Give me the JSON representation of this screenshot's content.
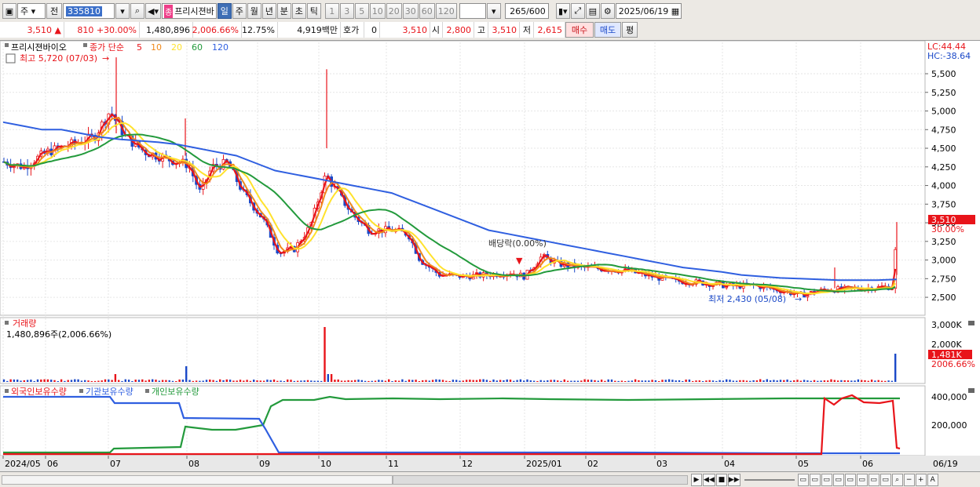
{
  "toolbar": {
    "market_type": "주",
    "prev_label": "전",
    "stock_code": "335810",
    "stock_name_badge": "종",
    "stock_name": "프리시젼바",
    "periods": [
      "일",
      "주",
      "월",
      "년",
      "분",
      "초",
      "틱"
    ],
    "active_period": "일",
    "intervals": [
      "1",
      "3",
      "5",
      "10",
      "20",
      "30",
      "60",
      "120"
    ],
    "data_count": "265",
    "data_total": "/600",
    "date": "2025/06/19"
  },
  "quote": {
    "price": "3,510",
    "change": "810",
    "change_pct": "+30.00%",
    "volume": "1,480,896",
    "volume_ratio": "2,006.66%",
    "turnover": "12.75%",
    "amount": "4,919백만",
    "hoga_label": "호가",
    "hoga_value": "0",
    "hoga_price": "3,510",
    "open_label": "시",
    "open": "2,800",
    "high_label": "고",
    "high": "3,510",
    "low_label": "저",
    "low": "2,615",
    "buy_label": "매수",
    "sell_label": "매도",
    "eval_label": "평"
  },
  "price_panel": {
    "legend_name": "프리시젼바이오",
    "legend_ma_title": "종가 단순",
    "ma_periods": [
      "5",
      "10",
      "20",
      "60",
      "120"
    ],
    "ma_colors": [
      "#e8141a",
      "#f08a1c",
      "#ffe22d",
      "#239a3c",
      "#2f5fe0"
    ],
    "max_label": "최고 5,720 (07/03)",
    "min_label": "최저 2,430 (05/08)",
    "dividend_label": "배당락(0.00%)",
    "lc_label": "LC:44.44",
    "hc_label": "HC:-38.64",
    "last_price_tag": "3,510",
    "last_pct_tag": "30.00%",
    "y_ticks": [
      "5,500",
      "5,250",
      "5,000",
      "4,750",
      "4,500",
      "4,250",
      "4,000",
      "3,750",
      "3,500",
      "3,250",
      "3,000",
      "2,750",
      "2,500"
    ]
  },
  "volume_panel": {
    "title": "거래량",
    "value": "1,480,896주(2,006.66%)",
    "y_ticks": [
      "3,000K",
      "2,000K",
      "1,000K"
    ],
    "last_tag": "1,481K",
    "last_pct_tag": "2006.66%"
  },
  "holdings_panel": {
    "legends": [
      "외국인보유수량",
      "기관보유수량",
      "개인보유수량"
    ],
    "legend_colors": [
      "#e8141a",
      "#2f5fe0",
      "#239a3c"
    ],
    "y_ticks": [
      "400,000",
      "200,000"
    ]
  },
  "x_axis": [
    "2024/05",
    "06",
    "07",
    "08",
    "09",
    "10",
    "11",
    "12",
    "2025/01",
    "02",
    "03",
    "04",
    "05",
    "06"
  ],
  "x_axis_right": "06/19",
  "colors": {
    "up": "#e8141a",
    "down": "#1b49c8",
    "selection": "#3f6fb6"
  },
  "chart_data": {
    "type": "line",
    "series": [
      {
        "name": "5",
        "values": [
          4300,
          4350,
          4600,
          4750,
          5000,
          4650,
          4400,
          4250,
          4150,
          3900,
          4100,
          4250,
          3700,
          3300,
          3100,
          3400,
          4100,
          3800,
          3500,
          3450,
          3300,
          3100,
          2900,
          2800,
          2780,
          2800,
          2820,
          2850,
          3050,
          2980,
          2900,
          2870,
          2820,
          2800,
          2750,
          2720,
          2700,
          2680,
          2700,
          2650,
          2600,
          2580,
          2620,
          2600,
          2620,
          2700,
          3510
        ]
      },
      {
        "name": "120",
        "values": [
          4850,
          4800,
          4750,
          4750,
          4700,
          4650,
          4620,
          4600,
          4580,
          4550,
          4500,
          4450,
          4400,
          4300,
          4200,
          4150,
          4100,
          4050,
          4000,
          3950,
          3900,
          3800,
          3700,
          3600,
          3500,
          3400,
          3350,
          3300,
          3250,
          3200,
          3150,
          3100,
          3050,
          3000,
          2950,
          2900,
          2870,
          2840,
          2800,
          2780,
          2760,
          2750,
          2740,
          2730,
          2730,
          2730,
          2740
        ]
      }
    ],
    "y_range": [
      2430,
      5720
    ]
  }
}
